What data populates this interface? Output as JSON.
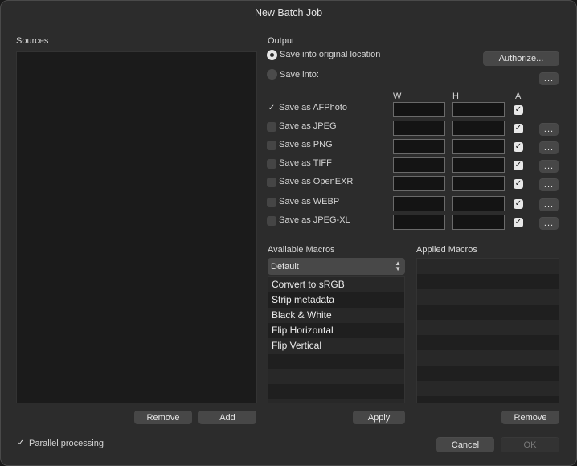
{
  "window": {
    "title": "New Batch Job"
  },
  "sources": {
    "label": "Sources",
    "remove_label": "Remove",
    "add_label": "Add"
  },
  "output": {
    "label": "Output",
    "save_original_label": "Save into original location",
    "save_into_label": "Save into:",
    "authorize_label": "Authorize...",
    "browse_label": "...",
    "col_w": "W",
    "col_h": "H",
    "col_a": "A",
    "formats": [
      {
        "label": "Save as AFPhoto",
        "checked": true,
        "a_checked": true,
        "has_options": false
      },
      {
        "label": "Save as JPEG",
        "checked": false,
        "a_checked": true,
        "has_options": true
      },
      {
        "label": "Save as PNG",
        "checked": false,
        "a_checked": true,
        "has_options": true
      },
      {
        "label": "Save as TIFF",
        "checked": false,
        "a_checked": true,
        "has_options": true
      },
      {
        "label": "Save as OpenEXR",
        "checked": false,
        "a_checked": true,
        "has_options": true
      },
      {
        "label": "Save as WEBP",
        "checked": false,
        "a_checked": true,
        "has_options": true
      },
      {
        "label": "Save as JPEG-XL",
        "checked": false,
        "a_checked": true,
        "has_options": true
      }
    ],
    "options_label": "..."
  },
  "available_macros": {
    "label": "Available Macros",
    "category_selected": "Default",
    "items": [
      "Convert to sRGB",
      "Strip metadata",
      "Black & White",
      "Flip Horizontal",
      "Flip Vertical",
      "",
      "",
      "",
      ""
    ],
    "apply_label": "Apply"
  },
  "applied_macros": {
    "label": "Applied Macros",
    "remove_label": "Remove"
  },
  "footer": {
    "parallel_label": "Parallel processing",
    "parallel_checked": true,
    "cancel_label": "Cancel",
    "ok_label": "OK"
  }
}
